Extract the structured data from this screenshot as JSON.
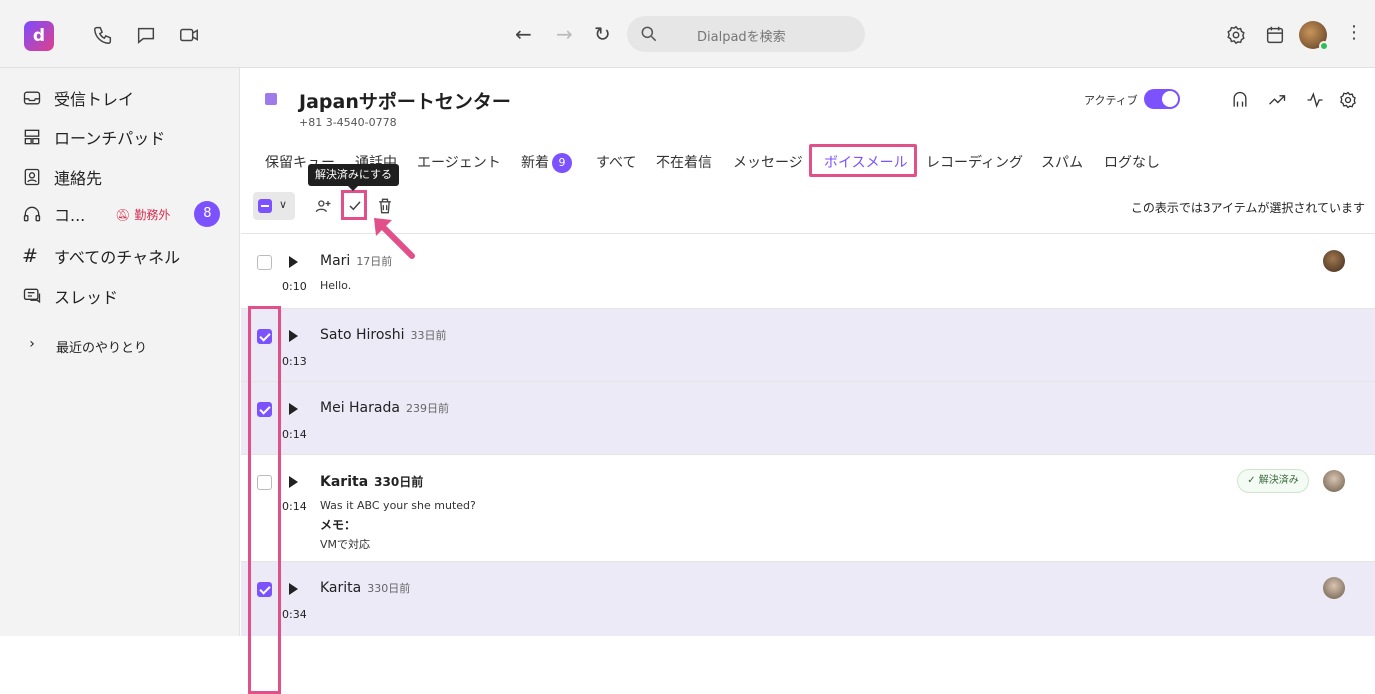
{
  "topbar": {
    "logo_text": "d",
    "search_placeholder": "Dialpadを検索"
  },
  "sidebar": {
    "items": [
      {
        "label": "受信トレイ",
        "icon": "inbox-icon"
      },
      {
        "label": "ローンチパッド",
        "icon": "launchpad-icon"
      },
      {
        "label": "連絡先",
        "icon": "contacts-icon"
      },
      {
        "label": "コ...",
        "icon": "headset-icon",
        "status": "勤務外",
        "badge": "8"
      },
      {
        "label": "すべてのチャネル",
        "icon": "hash-icon"
      },
      {
        "label": "スレッド",
        "icon": "threads-icon"
      }
    ],
    "recent_label": "最近のやりとり"
  },
  "header": {
    "queue_name": "Japanサポートセンター",
    "phone": "+81 3-4540-0778",
    "active_label": "アクティブ",
    "active": true
  },
  "tabs": [
    {
      "label": "保留キュー"
    },
    {
      "label": "通話中"
    },
    {
      "label": "エージェント"
    },
    {
      "label": "新着",
      "badge": "9"
    },
    {
      "label": "すべて"
    },
    {
      "label": "不在着信"
    },
    {
      "label": "メッセージ"
    },
    {
      "label": "ボイスメール",
      "active": true
    },
    {
      "label": "レコーディング"
    },
    {
      "label": "スパム"
    },
    {
      "label": "ログなし"
    }
  ],
  "toolbar": {
    "tooltip": "解決済みにする",
    "selection_text": "この表示では3アイテムが選択されています"
  },
  "voicemails": [
    {
      "name": "Mari",
      "age": "17日前",
      "duration": "0:10",
      "text": "Hello.",
      "checked": false,
      "bold": false
    },
    {
      "name": "Sato Hiroshi",
      "age": "33日前",
      "duration": "0:13",
      "text": "",
      "checked": true,
      "bold": false
    },
    {
      "name": "Mei Harada",
      "age": "239日前",
      "duration": "0:14",
      "text": "",
      "checked": true,
      "bold": false
    },
    {
      "name": "Karita",
      "age": "330日前",
      "duration": "0:14",
      "text": "Was it ABC your she muted?",
      "memo_label": "メモ：",
      "memo": "VMで対応",
      "checked": false,
      "bold": true,
      "resolved": "解決済み"
    },
    {
      "name": "Karita",
      "age": "330日前",
      "duration": "0:34",
      "text": "",
      "checked": true,
      "bold": false
    }
  ],
  "colors": {
    "accent": "#7c52ff",
    "highlight": "#e2508a",
    "selected_row": "#edeaf8"
  }
}
